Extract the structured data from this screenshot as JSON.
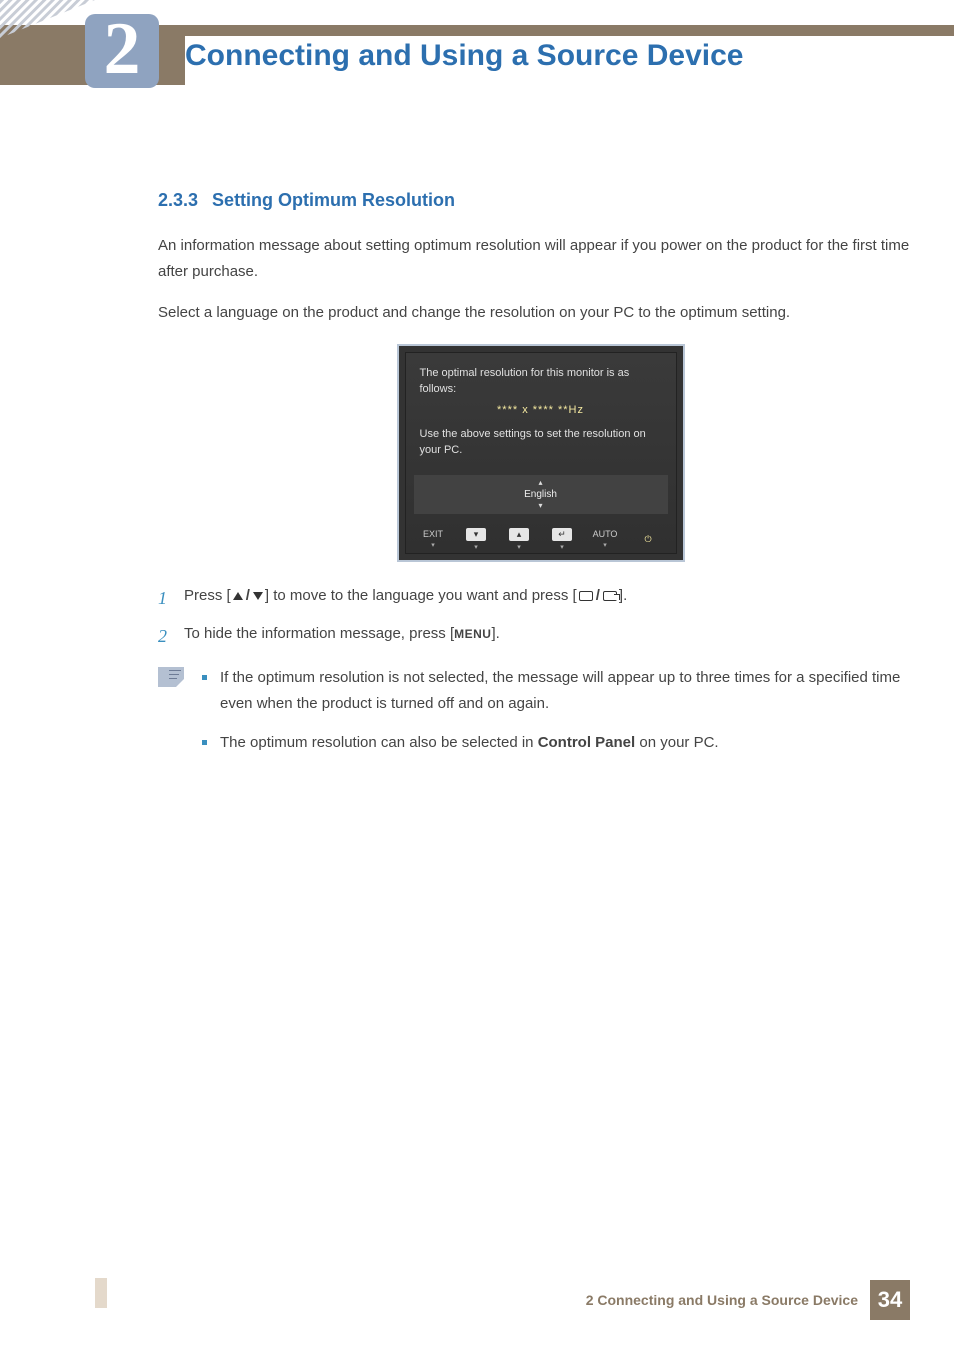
{
  "header": {
    "chapter_number": "2",
    "chapter_title": "Connecting and Using a Source Device"
  },
  "section": {
    "number": "2.3.3",
    "title": "Setting Optimum Resolution",
    "intro_p1": "An information message about setting optimum resolution will appear if you power on the product for the first time after purchase.",
    "intro_p2": "Select a language on the product and change the resolution on your PC to the optimum setting."
  },
  "osd": {
    "line1": "The optimal resolution for this monitor is as follows:",
    "resolution": "**** x ****   **Hz",
    "line2": "Use the above settings to set the resolution on your PC.",
    "language": "English",
    "buttons": {
      "exit": "EXIT",
      "auto": "AUTO",
      "caret": "▾"
    }
  },
  "steps": {
    "s1_a": "Press [",
    "s1_b": "] to move to the language you want and press [",
    "s1_c": "].",
    "s2_a": "To hide the information message, press [",
    "s2_b": "].",
    "menu_label": "MENU"
  },
  "notes": {
    "n1_a": "If the optimum resolution is not selected, the message will appear up to three times for a specified time even when the product is turned off and on again.",
    "n2_a": "The optimum resolution can also be selected in ",
    "n2_bold": "Control Panel",
    "n2_b": " on your PC."
  },
  "footer": {
    "text": "2 Connecting and Using a Source Device",
    "page": "34"
  }
}
